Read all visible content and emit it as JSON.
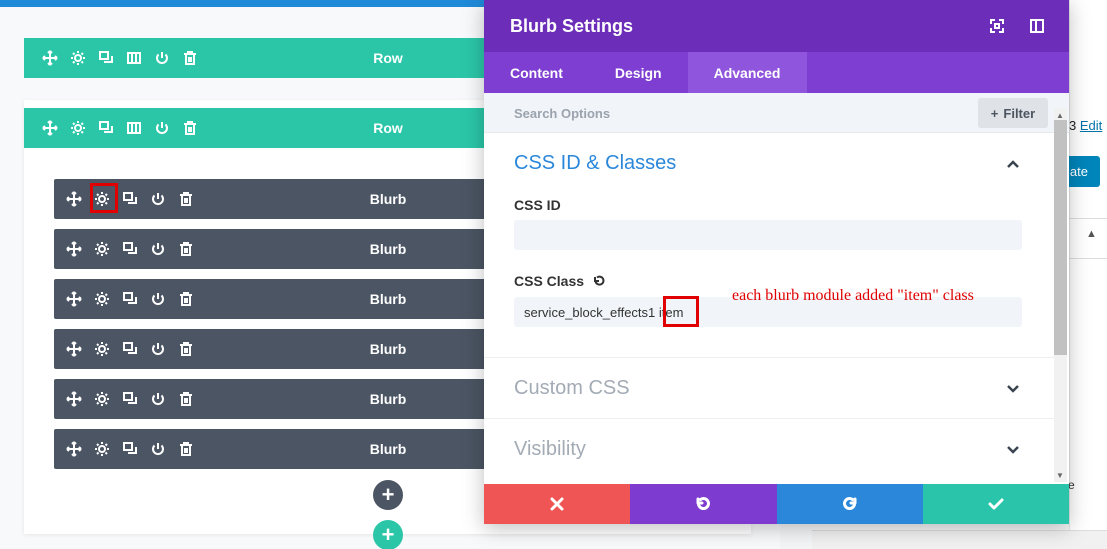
{
  "rows": [
    {
      "label": "Row"
    },
    {
      "label": "Row"
    }
  ],
  "blurbs": [
    {
      "label": "Blurb"
    },
    {
      "label": "Blurb"
    },
    {
      "label": "Blurb"
    },
    {
      "label": "Blurb"
    },
    {
      "label": "Blurb"
    },
    {
      "label": "Blurb"
    }
  ],
  "add_buttons": {
    "module": "+",
    "row": "+"
  },
  "wp_sidebar": {
    "edit_prefix": "3",
    "edit_link": "Edit",
    "update_label": "ate",
    "misc_letter": "e"
  },
  "modal": {
    "title": "Blurb Settings",
    "tabs": [
      {
        "label": "Content",
        "active": false
      },
      {
        "label": "Design",
        "active": false
      },
      {
        "label": "Advanced",
        "active": true
      }
    ],
    "search_placeholder": "Search Options",
    "filter_label": "Filter",
    "sections": {
      "css": {
        "title": "CSS ID & Classes",
        "css_id_label": "CSS ID",
        "css_id_value": "",
        "css_class_label": "CSS Class",
        "css_class_value": "service_block_effects1 item"
      },
      "custom_css": {
        "title": "Custom CSS"
      },
      "visibility": {
        "title": "Visibility"
      }
    }
  },
  "annotation": "each blurb module added \"item\" class",
  "colors": {
    "modal_header": "#6c2eb9",
    "tab_bar": "#7d3ed1",
    "row_bar": "#2bc6a8",
    "module_bar": "#4b5563",
    "accent_blue": "#2b87da",
    "cancel": "#ef5555",
    "save": "#29c4a9",
    "highlight": "#e00000"
  }
}
